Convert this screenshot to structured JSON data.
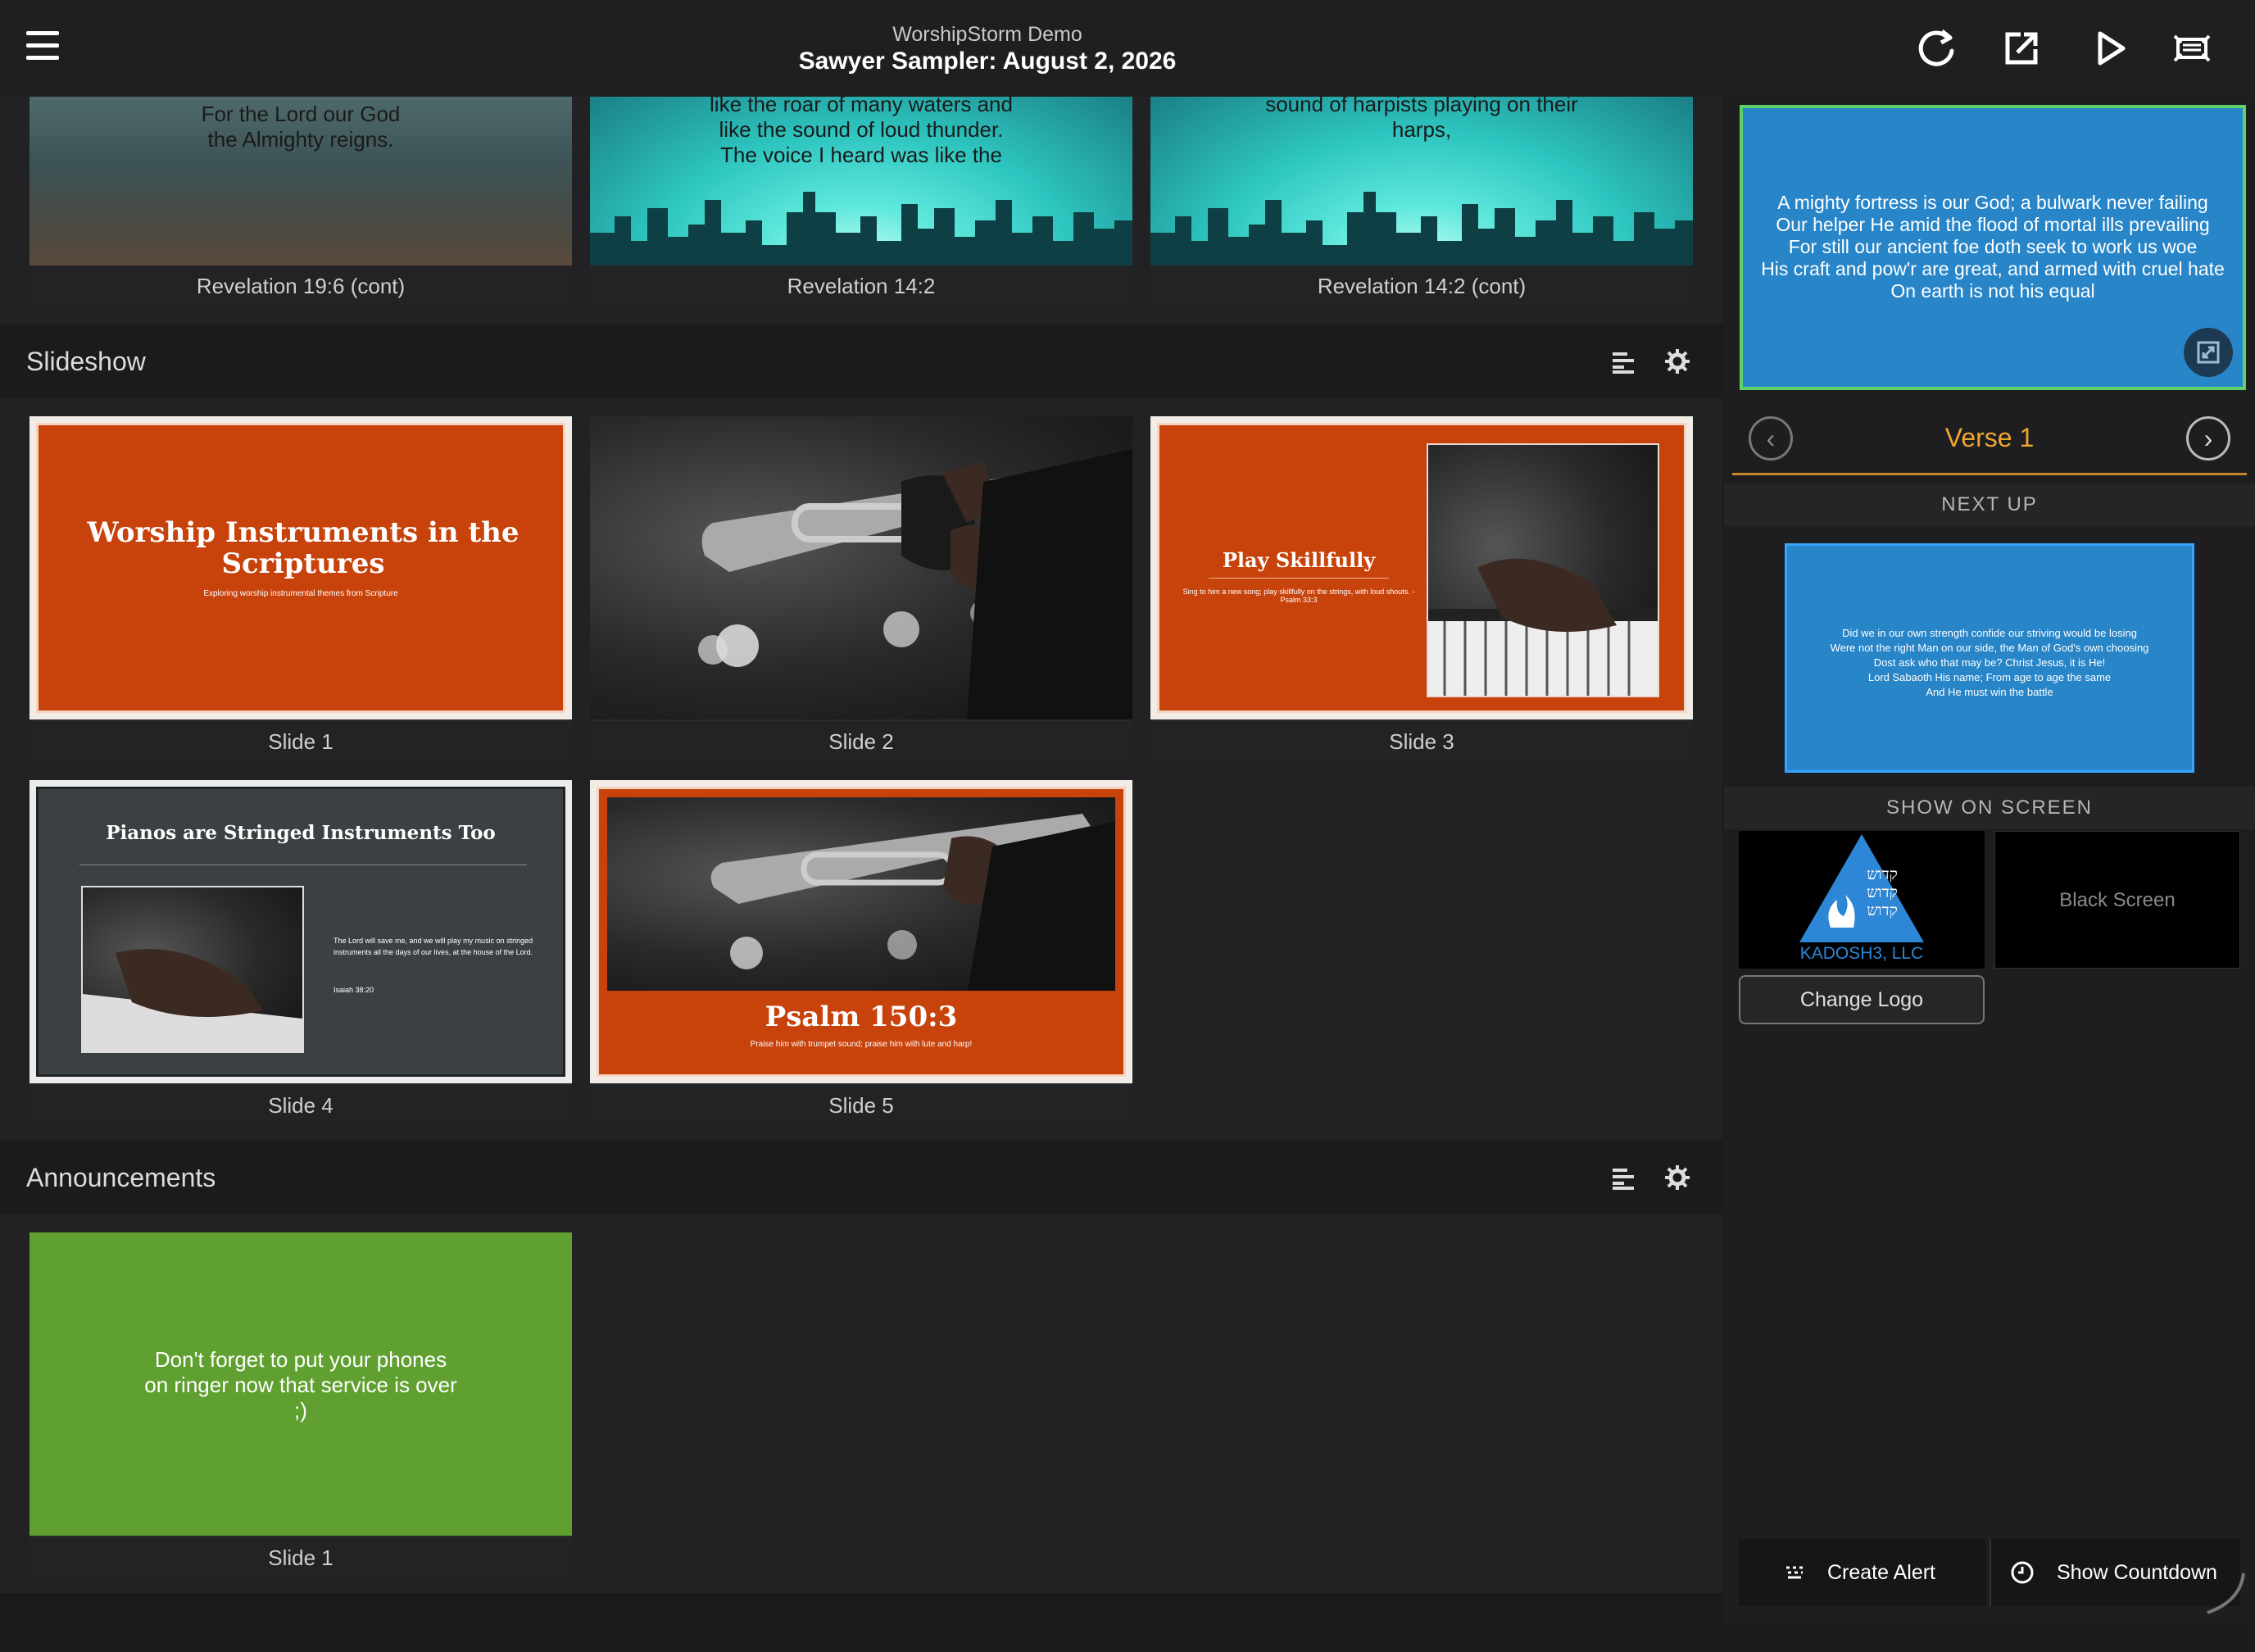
{
  "header": {
    "subtitle": "WorshipStorm Demo",
    "title": "Sawyer Sampler: August 2, 2026",
    "icons": [
      "refresh-icon",
      "export-icon",
      "play-icon",
      "screen-icon"
    ]
  },
  "scripture_row": [
    {
      "caption": "Revelation 19:6 (cont)",
      "text": "For the Lord our God\nthe Almighty reigns."
    },
    {
      "caption": "Revelation 14:2",
      "text": "like the roar of many waters and\nlike the sound of loud thunder.\nThe voice I heard was like the"
    },
    {
      "caption": "Revelation 14:2 (cont)",
      "text": "sound of harpists playing on their\nharps,"
    }
  ],
  "slideshow": {
    "label": "Slideshow",
    "slides": [
      {
        "caption": "Slide 1",
        "title": "Worship Instruments in the Scriptures",
        "subtitle": "Exploring worship instrumental themes from Scripture"
      },
      {
        "caption": "Slide 2"
      },
      {
        "caption": "Slide 3",
        "title": "Play Skillfully",
        "subtitle": "Sing to him a new song; play skillfully on the strings, with loud shouts. - Psalm 33:3"
      },
      {
        "caption": "Slide 4",
        "title": "Pianos are Stringed Instruments Too",
        "bullet1": "The Lord will save me, and we will play my music on stringed instruments all the days of our lives, at the house of the Lord.",
        "bullet2": "Isaiah 38:20"
      },
      {
        "caption": "Slide 5",
        "title": "Psalm 150:3",
        "subtitle": "Praise him with trumpet sound; praise him with lute and harp!"
      }
    ]
  },
  "announcements": {
    "label": "Announcements",
    "slides": [
      {
        "caption": "Slide 1",
        "text": "Don't forget to put your phones\non ringer now that service is over\n;)"
      }
    ]
  },
  "right_panel": {
    "live_text": "A mighty fortress is our God; a bulwark never failing\nOur helper He amid the flood of mortal ills prevailing\nFor still our ancient foe doth seek to work us woe\nHis craft and pow'r are great, and armed with cruel hate\nOn earth is not his equal",
    "verse_label": "Verse 1",
    "next_up_label": "NEXT UP",
    "next_up_text": "Did we in our own strength confide our striving would be losing\nWere not the right Man on our side, the Man of God's own choosing\nDost ask who that may be? Christ Jesus, it is He!\nLord Sabaoth His name; From age to age the same\nAnd He must win the battle",
    "show_on_screen_label": "SHOW ON SCREEN",
    "logo_text": "KADOSH3, LLC",
    "logo_hebrew": "קדוש\nקדוש\nקדוש",
    "black_screen_label": "Black Screen",
    "change_logo_label": "Change Logo",
    "create_alert_label": "Create Alert",
    "show_countdown_label": "Show Countdown"
  },
  "colors": {
    "live_border": "#5fd16a",
    "verse_accent": "#f0a52e",
    "slide_orange": "#c8420b",
    "announcement_green": "#5fa030",
    "lyric_blue": "#2785c8"
  }
}
